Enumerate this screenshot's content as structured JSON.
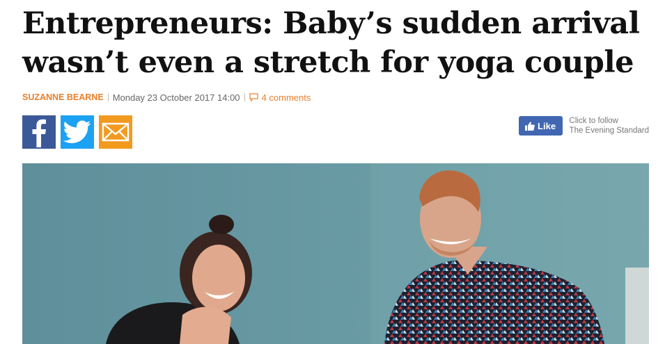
{
  "article": {
    "headline": "Entrepreneurs: Baby’s sudden arrival wasn’t even a stretch for yoga couple",
    "author": "SUZANNE BEARNE",
    "date": "Monday 23 October 2017 14:00",
    "comments": "4 comments"
  },
  "share": {
    "icons": [
      "facebook-icon",
      "twitter-icon",
      "email-icon"
    ]
  },
  "social": {
    "like_label": "Like",
    "follow_line1": "Click to follow",
    "follow_line2": "The Evening Standard"
  },
  "colors": {
    "author_accent": "#e8802c",
    "facebook": "#3b5998",
    "twitter": "#1da1f2",
    "email": "#f29a20",
    "like_button": "#4267b2",
    "photo_background": "#6a9ba5"
  }
}
